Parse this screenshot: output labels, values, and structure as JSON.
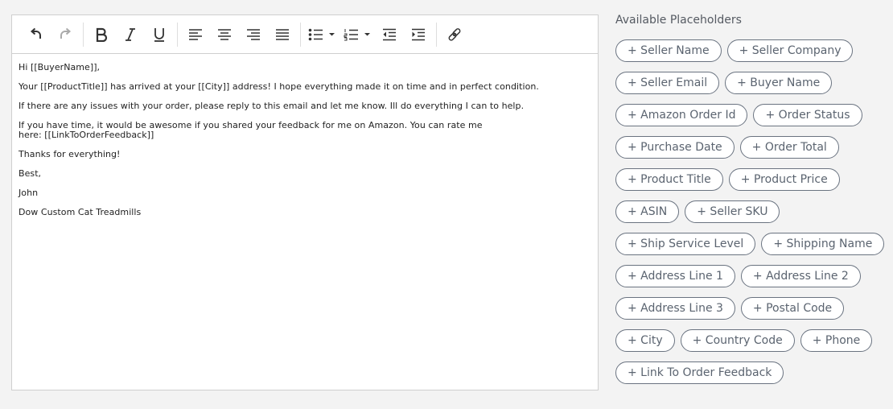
{
  "editor": {
    "toolbar": {
      "buttons": [
        {
          "name": "undo-button",
          "icon": "undo-icon",
          "enabled": true
        },
        {
          "name": "redo-button",
          "icon": "redo-icon",
          "enabled": false
        },
        {
          "name": "bold-button",
          "icon": "bold-icon"
        },
        {
          "name": "italic-button",
          "icon": "italic-icon"
        },
        {
          "name": "underline-button",
          "icon": "underline-icon"
        },
        {
          "name": "align-left-button",
          "icon": "align-left-icon"
        },
        {
          "name": "align-center-button",
          "icon": "align-center-icon"
        },
        {
          "name": "align-right-button",
          "icon": "align-right-icon"
        },
        {
          "name": "align-justify-button",
          "icon": "align-justify-icon"
        },
        {
          "name": "bullet-list-button",
          "icon": "bullet-list-icon"
        },
        {
          "name": "numbered-list-button",
          "icon": "numbered-list-icon"
        },
        {
          "name": "outdent-button",
          "icon": "outdent-icon"
        },
        {
          "name": "indent-button",
          "icon": "indent-icon"
        },
        {
          "name": "link-button",
          "icon": "link-icon"
        }
      ]
    },
    "content": {
      "greeting": "Hi [[BuyerName]],",
      "arrival": "Your [[ProductTitle]] has arrived at your [[City]] address! I hope everything made it on time and in perfect condition.",
      "issues": "If there are any issues with your order, please reply to this email and let me know. Ill do everything I can to help.",
      "feedback": "If you have time, it would be awesome if you shared your feedback for me on Amazon. You can rate me\nhere: [[LinkToOrderFeedback]]",
      "thanks": "Thanks for everything!",
      "signoff": "Best,",
      "name": "John",
      "company": "Dow Custom Cat Treadmills"
    }
  },
  "placeholders": {
    "title": "Available Placeholders",
    "items": [
      "+ Seller Name",
      "+ Seller Company",
      "+ Seller Email",
      "+ Buyer Name",
      "+ Amazon Order Id",
      "+ Order Status",
      "+ Purchase Date",
      "+ Order Total",
      "+ Product Title",
      "+ Product Price",
      "+ ASIN",
      "+ Seller SKU",
      "+ Ship Service Level",
      "+ Shipping Name",
      "+ Address Line 1",
      "+ Address Line 2",
      "+ Address Line 3",
      "+ Postal Code",
      "+ City",
      "+ Country Code",
      "+ Phone",
      "+ Link To Order Feedback"
    ]
  },
  "colors": {
    "chip_border": "#6a7380",
    "chip_text": "#5b6470",
    "icon": "#333333",
    "icon_disabled": "#aaaaaa",
    "page_background": "#f3f3f3"
  }
}
